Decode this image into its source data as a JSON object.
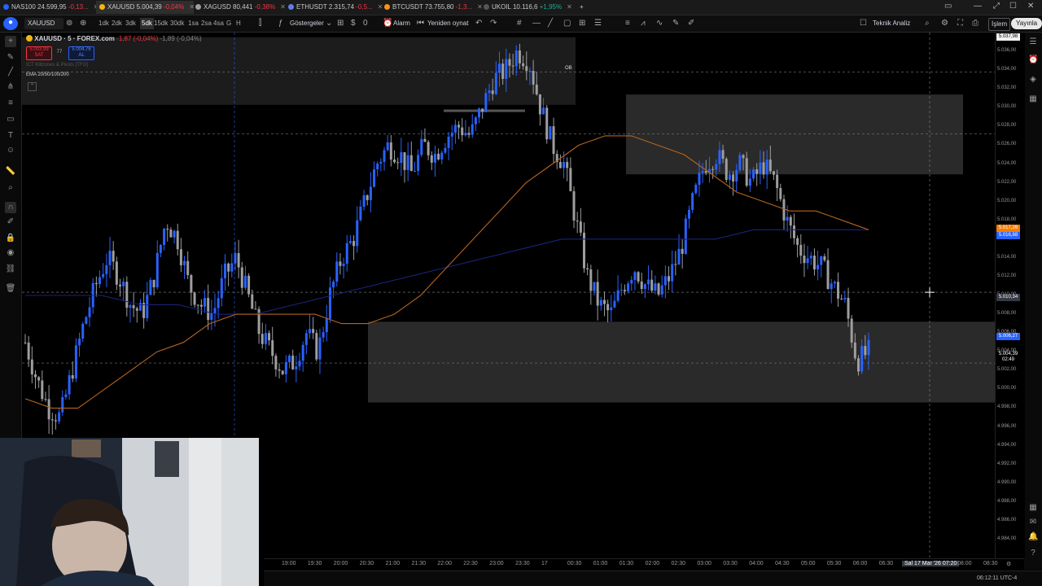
{
  "tabs": [
    {
      "symbol": "NAS100",
      "price": "24.599,95",
      "change": "-0,13...",
      "dir": "neg",
      "color": "#2962ff",
      "active": false
    },
    {
      "symbol": "XAUUSD",
      "price": "5.004,39",
      "change": "-0,04%",
      "dir": "neg",
      "color": "#f0b90b",
      "active": true
    },
    {
      "symbol": "XAGUSD",
      "price": "80,441",
      "change": "-0,38%",
      "dir": "neg",
      "color": "#9e9e9e",
      "active": false
    },
    {
      "symbol": "ETHUSDT",
      "price": "2.315,74",
      "change": "-0,5...",
      "dir": "neg",
      "color": "#627eea",
      "active": false
    },
    {
      "symbol": "BTCUSDT",
      "price": "73.755,80",
      "change": "-1,3...",
      "dir": "neg",
      "color": "#f7931a",
      "active": false
    },
    {
      "symbol": "UKOIL",
      "price": "10.116,6",
      "change": "+1,95%",
      "dir": "pos",
      "color": "#555555",
      "active": false
    }
  ],
  "toolbar": {
    "symbol": "XAUUSD",
    "timeframes": [
      "1dk",
      "2dk",
      "3dk",
      "5dk",
      "15dk",
      "30dk",
      "1sa",
      "2sa",
      "4sa",
      "G",
      "H"
    ],
    "selected_timeframe": "5dk",
    "indicators_label": "Göstergeler",
    "alarm_label": "Alarm",
    "replay_label": "Yeniden oynat",
    "tech_analysis_label": "Teknik Analiz",
    "trade_label": "İşlem",
    "publish_label": "Yayınla"
  },
  "legend": {
    "title": "XAUUSD · 5 · FOREX.com",
    "change": "-1,87 (-0,04%)",
    "change2": "-1,89 (-0,04%)",
    "sell_price": "5.003,99",
    "sell_label": "SAT",
    "spread": "77",
    "buy_price": "5.004,76",
    "buy_label": "AL",
    "indicator1": "ICT Killzones & Pivots [TFO]",
    "indicator2": "EMA 20/50/100/200"
  },
  "chart_data": {
    "type": "candlestick",
    "symbol": "XAUUSD",
    "interval": "5",
    "x_ticks": [
      "19:00",
      "19:30",
      "20:00",
      "20:30",
      "21:00",
      "21:30",
      "22:00",
      "22:30",
      "23:00",
      "23:30",
      "17",
      "00:30",
      "01:00",
      "01:30",
      "02:00",
      "02:30",
      "03:00",
      "03:30",
      "04:00",
      "04:30",
      "05:00",
      "05:30",
      "06:00",
      "06:30"
    ],
    "crosshair_time": "Sal 17 Mar '26  07:20",
    "extra_time_ticks": [
      "08:00",
      "08:30"
    ],
    "y_ticks": [
      5036,
      5034,
      5032,
      5030,
      5028,
      5026,
      5024,
      5022,
      5020,
      5018,
      5016,
      5014,
      5012,
      5010,
      5008,
      5006,
      5004,
      5002,
      5000,
      4998,
      4996,
      4994,
      4992,
      4990,
      4988,
      4986,
      4984
    ],
    "y_tick_labels": [
      "5.036,00",
      "5.034,00",
      "5.032,00",
      "5.030,00",
      "5.028,00",
      "5.026,00",
      "5.024,00",
      "5.022,00",
      "5.020,00",
      "5.018,00",
      "5.016,00",
      "5.014,00",
      "5.012,00",
      "5.010,00",
      "5.008,00",
      "5.006,00",
      "5.004,00",
      "5.002,00",
      "5.000,00",
      "4.998,00",
      "4.996,00",
      "4.994,00",
      "4.992,00",
      "4.990,00",
      "4.988,00",
      "4.986,00",
      "4.984,00"
    ],
    "ylim": [
      4982,
      5038
    ],
    "last_price": "5.004,39",
    "countdown": "02:49",
    "crosshair_price": "5.010,34",
    "ema_labels": [
      "5.017,26",
      "5.016,88",
      "5.006,27"
    ],
    "top_label": "5.037,98",
    "ob_label": "OB",
    "close_path": [
      5005,
      5001,
      4998,
      4997,
      5002,
      5007,
      5011,
      5014,
      5012,
      5009,
      5008,
      5012,
      5018,
      5016,
      5011,
      5009,
      5008,
      5012,
      5014,
      5010,
      5006,
      5004,
      5002,
      5003,
      5006,
      5004,
      5010,
      5014,
      5016,
      5020,
      5024,
      5026,
      5025,
      5023,
      5026,
      5025,
      5027,
      5028,
      5027,
      5030,
      5033,
      5034,
      5036,
      5035,
      5030,
      5026,
      5024,
      5018,
      5012,
      5009,
      5008,
      5011,
      5013,
      5011,
      5010,
      5012,
      5015,
      5020,
      5024,
      5025,
      5023,
      5024,
      5022,
      5024,
      5022,
      5018,
      5015,
      5014,
      5013,
      5011,
      5009,
      5003,
      5004
    ],
    "ema_fast": [
      4999,
      4998,
      4998,
      5000,
      5002,
      5004,
      5005,
      5007,
      5008,
      5008,
      5008,
      5008,
      5007,
      5007,
      5008,
      5010,
      5013,
      5016,
      5019,
      5022,
      5024,
      5026,
      5027,
      5027,
      5026,
      5025,
      5023,
      5021,
      5020,
      5019,
      5019,
      5018,
      5017
    ],
    "ema_slow": [
      5010,
      5010,
      5010,
      5009,
      5009,
      5008,
      5008,
      5009,
      5010,
      5011,
      5012,
      5013,
      5014,
      5015,
      5016,
      5016,
      5016,
      5016,
      5016,
      5017,
      5017,
      5017,
      5017
    ]
  },
  "colors": {
    "bull": "#2962ff",
    "bear": "#9e9e9e",
    "ema_fast": "#b5651d",
    "ema_slow": "#1a237e",
    "zone": "#2a2a2a",
    "badge_blue": "#2962ff",
    "badge_orange": "#f57c00"
  },
  "status": {
    "clock": "06:12:11 UTC-4"
  }
}
